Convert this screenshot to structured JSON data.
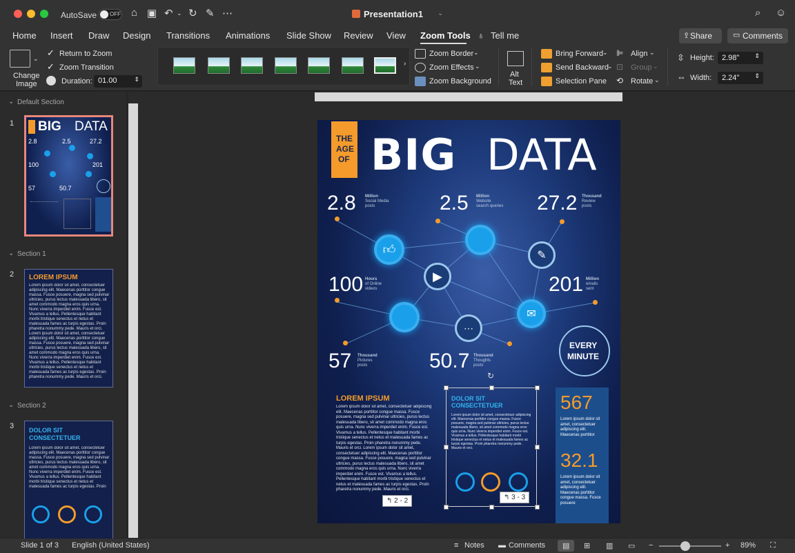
{
  "titlebar": {
    "autosave_label": "AutoSave",
    "autosave_state": "OFF",
    "document_title": "Presentation1"
  },
  "tabs": [
    "Home",
    "Insert",
    "Draw",
    "Design",
    "Transitions",
    "Animations",
    "Slide Show",
    "Review",
    "View",
    "Zoom Tools",
    "Tell me"
  ],
  "active_tab": "Zoom Tools",
  "share_label": "Share",
  "comments_label": "Comments",
  "ribbon": {
    "change_image": [
      "Change",
      "Image"
    ],
    "return_to_zoom": "Return to Zoom",
    "zoom_transition": "Zoom Transition",
    "duration_label": "Duration:",
    "duration_value": "01.00",
    "zoom_border": "Zoom Border",
    "zoom_effects": "Zoom Effects",
    "zoom_background": "Zoom Background",
    "alt_text": [
      "Alt",
      "Text"
    ],
    "bring_forward": "Bring Forward",
    "send_backward": "Send Backward",
    "selection_pane": "Selection Pane",
    "align": "Align",
    "group": "Group",
    "rotate": "Rotate",
    "height_label": "Height:",
    "height_value": "2.98\"",
    "width_label": "Width:",
    "width_value": "2.24\""
  },
  "left_panel": {
    "sections": [
      "Default Section",
      "Section 1",
      "Section 2"
    ],
    "slide_numbers": [
      "1",
      "2",
      "3"
    ]
  },
  "slide": {
    "the_age_of": [
      "THE",
      "AGE",
      "OF"
    ],
    "big": "BIG",
    "data": "DATA",
    "stats": [
      {
        "value": "2.8",
        "unit": "Million",
        "desc": [
          "Social Media",
          "posts"
        ]
      },
      {
        "value": "2.5",
        "unit": "Million",
        "desc": [
          "Website",
          "search queries"
        ]
      },
      {
        "value": "27.2",
        "unit": "Thousand",
        "desc": [
          "Review",
          "posts"
        ]
      },
      {
        "value": "100",
        "unit": "Hours",
        "desc": [
          "of Online",
          "videos"
        ]
      },
      {
        "value": "201",
        "unit": "Million",
        "desc": [
          "emails",
          "sent"
        ]
      },
      {
        "value": "57",
        "unit": "Thousand",
        "desc": [
          "Pictures",
          "posts"
        ]
      },
      {
        "value": "50.7",
        "unit": "Thousand",
        "desc": [
          "Thoughts",
          "posts"
        ]
      }
    ],
    "every_minute": [
      "EVERY",
      "MINUTE"
    ],
    "lorem_heading": "LOREM IPSUM",
    "dolor_heading": [
      "DOLOR SIT",
      "CONSECTETUER"
    ],
    "lorem_body": "Lorem ipsum dolor sit amet, consectetuer adipiscing elit. Maecenas porttitor congue massa. Fusce posuere, magna sed pulvinar ultricies, purus lectus malesuada libero, sit amet commodo magna eros quis urna. Nunc viverra imperdiet enim. Fusce est. Vivamus a tellus. Pellentesque habitant morbi tristique senectus et netus et malesuada fames ac turpis egestas. Proin pharetra nonummy pede. Mauris et orci. Lorem ipsum dolor sit amet, consectetuer adipiscing elit. Maecenas porttitor congue massa. Fusce posuere, magna sed pulvinar ultricies, purus lectus malesuada libero, sit amet commodo magna eros quis urna. Nunc viverra imperdiet enim. Fusce est. Vivamus a tellus. Pellentesque habitant morbi tristique senectus et netus et malesuada fames ac turpis egestas. Proin pharetra nonummy pede. Mauris et orci.",
    "dolor_body": "Lorem ipsum dolor sit amet, consectetuer adipiscing elit. Maecenas porttitor congue massa. Fusce posuere, magna sed pulvinar ultricies, purus lectus malesuada libero, sit amet commodo magna eros quis urna. Nunc viverra imperdiet enim. Fusce est. Vivamus a tellus. Pellentesque habitant morbi tristique senectus et netus et malesuada fames ac turpis egestas. Proin pharetra nonummy pede. Mauris et orci.",
    "big_stat_1": "567",
    "big_stat_1_text": "Lorem ipsum dolor sit amet, consectetuer adipiscing elit. Maecenas porttitor",
    "big_stat_2": "32.1",
    "big_stat_2_text": "Lorem ipsum dolor sit amet, consectetuer adipiscing elit. Maecenas porttitor congue massa. Fusce posuere",
    "zoom_tag_1": "2 - 2",
    "zoom_tag_2": "3 - 3"
  },
  "statusbar": {
    "slide_info": "Slide 1 of 3",
    "language": "English (United States)",
    "notes": "Notes",
    "comments": "Comments",
    "zoom": "89%"
  },
  "colors": {
    "accent_orange": "#f59b2b",
    "node_blue": "#1aa0ea",
    "slide_bg": "#0f1f4e",
    "selected_thumb_border": "#e8877a"
  }
}
